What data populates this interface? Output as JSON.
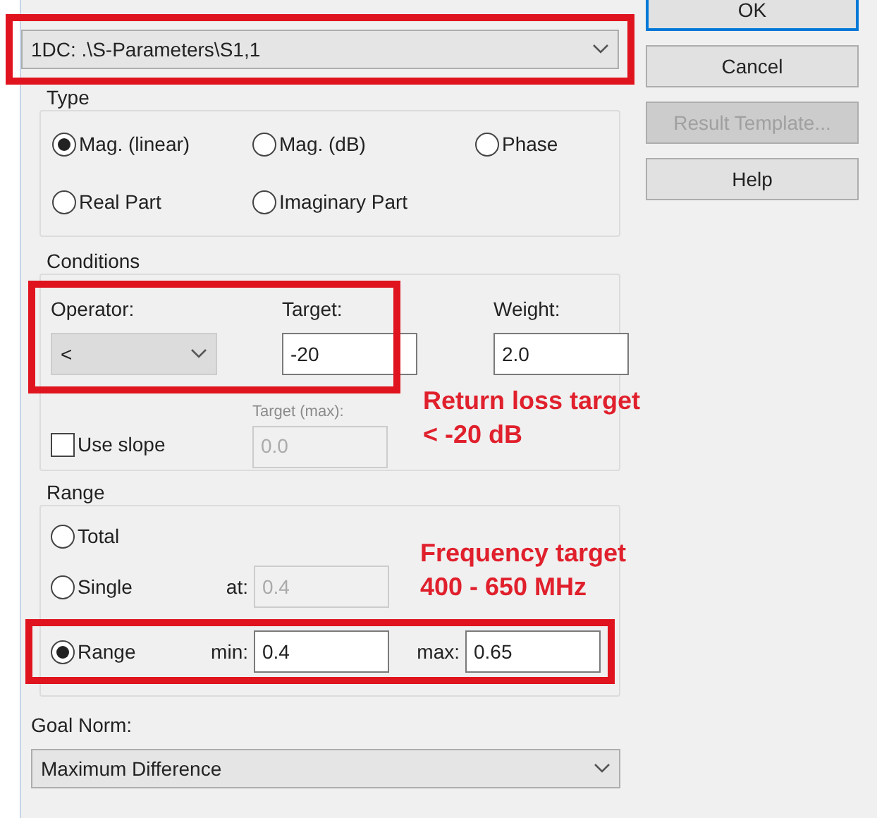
{
  "source": {
    "value": "1DC: .\\S-Parameters\\S1,1",
    "highlighted": true
  },
  "buttons": [
    {
      "label": "OK",
      "disabled": false,
      "default": true
    },
    {
      "label": "Cancel",
      "disabled": false,
      "default": false
    },
    {
      "label": "Result Template...",
      "disabled": true,
      "default": false
    },
    {
      "label": "Help",
      "disabled": false,
      "default": false
    }
  ],
  "type": {
    "title": "Type",
    "options": [
      {
        "label": "Mag. (linear)",
        "selected": true
      },
      {
        "label": "Mag. (dB)",
        "selected": false
      },
      {
        "label": "Phase",
        "selected": false
      },
      {
        "label": "Real Part",
        "selected": false
      },
      {
        "label": "Imaginary Part",
        "selected": false
      }
    ]
  },
  "conditions": {
    "title": "Conditions",
    "highlighted": true,
    "operator": {
      "label": "Operator:",
      "value": "<"
    },
    "target": {
      "label": "Target:",
      "value": "-20"
    },
    "weight": {
      "label": "Weight:",
      "value": "2.0"
    },
    "use_slope": {
      "label": "Use slope",
      "checked": false
    },
    "target_max": {
      "label": "Target (max):",
      "value": "0.0",
      "disabled": true
    }
  },
  "range": {
    "title": "Range",
    "options": [
      {
        "kind": "total",
        "label": "Total",
        "selected": false
      },
      {
        "kind": "single",
        "label": "Single",
        "selected": false,
        "at_label": "at:",
        "at_value": "0.4"
      },
      {
        "kind": "range",
        "label": "Range",
        "selected": true,
        "highlighted": true,
        "min_label": "min:",
        "min_value": "0.4",
        "max_label": "max:",
        "max_value": "0.65"
      }
    ]
  },
  "goal_norm": {
    "label": "Goal Norm:",
    "value": "Maximum Difference"
  },
  "annotations": [
    {
      "lines": [
        "Return loss target",
        "< -20 dB"
      ]
    },
    {
      "lines": [
        "Frequency target",
        "400 - 650 MHz"
      ]
    }
  ]
}
